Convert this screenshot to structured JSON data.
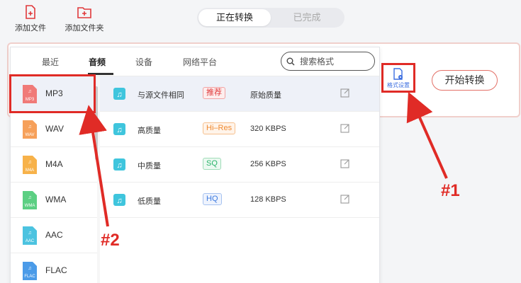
{
  "toolbar": {
    "add_file_label": "添加文件",
    "add_folder_label": "添加文件夹"
  },
  "status_tabs": [
    {
      "label": "正在转换",
      "active": true
    },
    {
      "label": "已完成",
      "active": false
    }
  ],
  "convert_panel": {
    "format_settings_label": "格式设置",
    "start_button_label": "开始转换"
  },
  "popup": {
    "tabs": [
      {
        "label": "最近",
        "active": false
      },
      {
        "label": "音频",
        "active": true
      },
      {
        "label": "设备",
        "active": false
      },
      {
        "label": "网络平台",
        "active": false
      }
    ],
    "search": {
      "placeholder": "搜索格式"
    },
    "formats": [
      {
        "name": "MP3",
        "icon_text": "MP3",
        "color": "#f07a78",
        "selected": true
      },
      {
        "name": "WAV",
        "icon_text": "WAV",
        "color": "#f6a05a",
        "selected": false
      },
      {
        "name": "M4A",
        "icon_text": "M4A",
        "color": "#f7b24a",
        "selected": false
      },
      {
        "name": "WMA",
        "icon_text": "WMA",
        "color": "#5ccf83",
        "selected": false
      },
      {
        "name": "AAC",
        "icon_text": "AAC",
        "color": "#4cc3e0",
        "selected": false
      },
      {
        "name": "FLAC",
        "icon_text": "FLAC",
        "color": "#4b9be8",
        "selected": false
      }
    ],
    "qualities": [
      {
        "label": "与源文件相同",
        "badge": "推荐",
        "badge_color": "#e0393b",
        "value": "原始质量"
      },
      {
        "label": "高质量",
        "badge": "Hi–Res",
        "badge_color": "#f08a30",
        "value": "320 KBPS"
      },
      {
        "label": "中质量",
        "badge": "SQ",
        "badge_color": "#29b36a",
        "value": "256 KBPS"
      },
      {
        "label": "低质量",
        "badge": "HQ",
        "badge_color": "#3d7be0",
        "value": "128 KBPS"
      }
    ]
  },
  "annotations": {
    "label_1": "#1",
    "label_2": "#2"
  },
  "colors": {
    "accent_red": "#e02b26",
    "start_border": "#e37168",
    "music_icon": "#3fc5dd"
  }
}
